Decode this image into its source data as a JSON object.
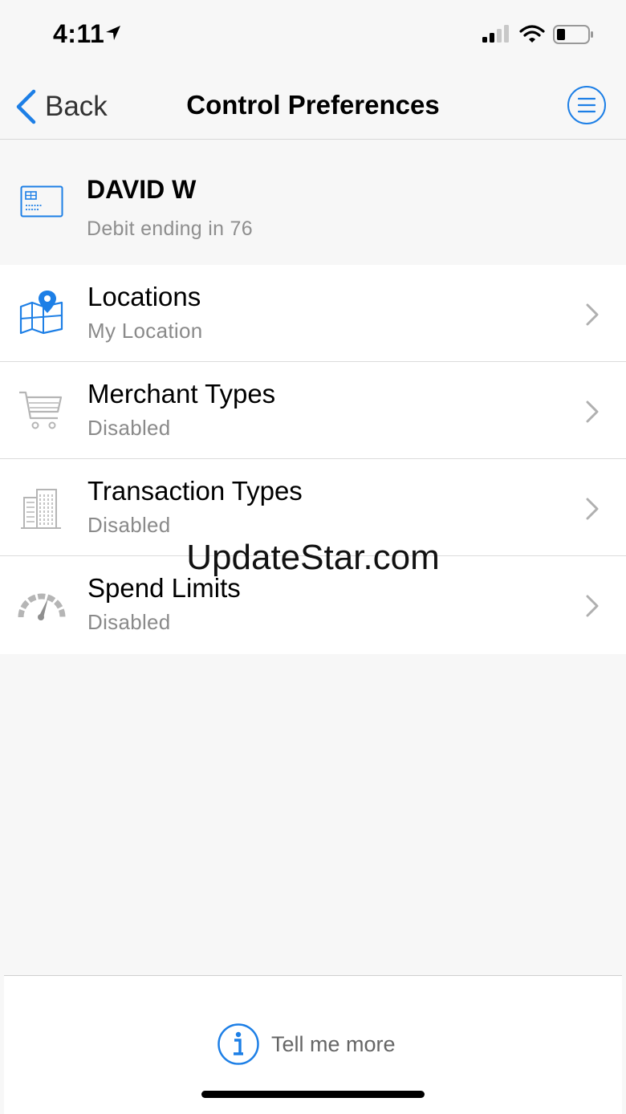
{
  "status_bar": {
    "time": "4:11"
  },
  "nav": {
    "back_label": "Back",
    "title": "Control Preferences",
    "menu_icon": "menu-icon"
  },
  "card": {
    "name": "DAVID W",
    "subtitle": "Debit ending in 76"
  },
  "items": [
    {
      "title": "Locations",
      "subtitle": "My Location",
      "icon": "map-pin-icon"
    },
    {
      "title": "Merchant Types",
      "subtitle": "Disabled",
      "icon": "shopping-cart-icon"
    },
    {
      "title": "Transaction Types",
      "subtitle": "Disabled",
      "icon": "building-icon"
    },
    {
      "title": "Spend Limits",
      "subtitle": "Disabled",
      "icon": "speedometer-icon"
    }
  ],
  "watermark": "UpdateStar.com",
  "footer": {
    "tell_more_label": "Tell me more"
  },
  "colors": {
    "accent": "#1d7fe6",
    "disabled_icon": "#b5b5b5"
  }
}
